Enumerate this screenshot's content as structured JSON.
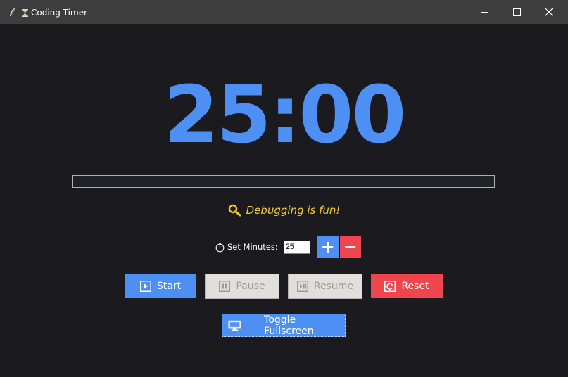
{
  "window": {
    "title": "Coding Timer",
    "title_icon": "hourglass-icon",
    "app_icon": "feather-icon",
    "controls": [
      "minimize-icon",
      "maximize-icon",
      "close-icon"
    ]
  },
  "timer": {
    "display": "25:00"
  },
  "progress": {
    "fraction": 0.0
  },
  "message": {
    "text": "Debugging is fun!",
    "icon": "magnifier-icon"
  },
  "minutes": {
    "label": "Set Minutes:",
    "label_icon": "stopwatch-icon",
    "value": "25",
    "increment_label": "+",
    "decrement_label": "−"
  },
  "controls": {
    "start": "Start",
    "pause": "Pause",
    "resume": "Resume",
    "reset": "Reset",
    "fullscreen": "Toggle Fullscreen"
  },
  "colors": {
    "accent_blue": "#4e8ff3",
    "accent_red": "#f0454d",
    "message_yellow": "#f3c832",
    "background": "#1b1b1f",
    "disabled_bg": "#e0dfdb",
    "disabled_text": "#9c9b98"
  }
}
